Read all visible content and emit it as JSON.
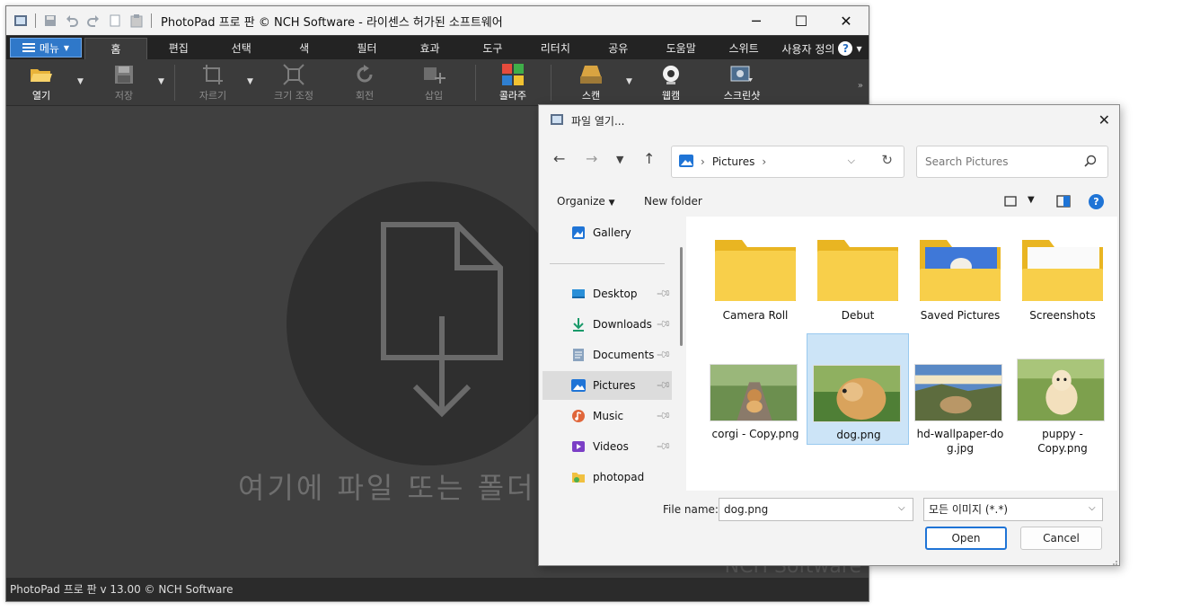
{
  "app": {
    "title": "PhotoPad 프로 판 © NCH Software - 라이센스 허가된 소프트웨어",
    "menu_label": "메뉴",
    "tabs": [
      {
        "label": "홈",
        "active": true
      },
      {
        "label": "편집"
      },
      {
        "label": "선택"
      },
      {
        "label": "색"
      },
      {
        "label": "필터"
      },
      {
        "label": "효과"
      },
      {
        "label": "도구"
      },
      {
        "label": "리터치"
      },
      {
        "label": "공유"
      },
      {
        "label": "도움말"
      },
      {
        "label": "스위트"
      }
    ],
    "custom_tab": "사용자 정의",
    "ribbon": {
      "open": "열기",
      "save": "저장",
      "crop": "자르기",
      "resize": "크기 조정",
      "rotate": "회전",
      "insert": "삽입",
      "collage": "콜라주",
      "scan": "스캔",
      "webcam": "웹캠",
      "screenshot": "스크린샷"
    },
    "drop_text": "여기에 파일 또는 폴더",
    "watermark": "NCH Software",
    "status": "PhotoPad 프로 판 v 13.00 © NCH Software"
  },
  "dialog": {
    "title": "파일 열기...",
    "breadcrumb": "Pictures",
    "search_placeholder": "Search Pictures",
    "organize": "Organize",
    "new_folder": "New folder",
    "nav_items": [
      {
        "label": "Gallery"
      },
      {
        "label": "Desktop",
        "pinned": true
      },
      {
        "label": "Downloads",
        "pinned": true
      },
      {
        "label": "Documents",
        "pinned": true
      },
      {
        "label": "Pictures",
        "pinned": true,
        "selected": true
      },
      {
        "label": "Music",
        "pinned": true
      },
      {
        "label": "Videos",
        "pinned": true
      },
      {
        "label": "photopad"
      }
    ],
    "folders": [
      {
        "name": "Camera Roll"
      },
      {
        "name": "Debut"
      },
      {
        "name": "Saved Pictures"
      },
      {
        "name": "Screenshots"
      }
    ],
    "files": [
      {
        "name": "corgi - Copy.png"
      },
      {
        "name": "dog.png",
        "selected": true
      },
      {
        "name": "hd-wallpaper-dog.jpg",
        "display": "hd-wallpaper-do\ng.jpg"
      },
      {
        "name": "puppy - Copy.png",
        "display": "puppy -\nCopy.png"
      }
    ],
    "file_name_label": "File name:",
    "file_name_value": "dog.png",
    "file_type": "모든 이미지 (*.*)",
    "open_label": "Open",
    "cancel_label": "Cancel"
  },
  "colors": {
    "accent": "#1f74d6",
    "menu_button": "#2f78c9",
    "app_bg": "#404040",
    "folder_yellow": "#f8cf4a",
    "selection": "#cce4f7"
  }
}
